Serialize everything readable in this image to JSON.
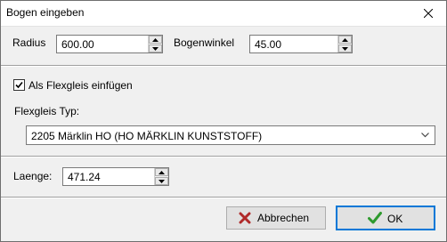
{
  "window": {
    "title": "Bogen eingeben"
  },
  "radius": {
    "label": "Radius",
    "value": "600.00"
  },
  "bogenwinkel": {
    "label": "Bogenwinkel",
    "value": "45.00"
  },
  "flexgleis": {
    "checkbox_label": "Als Flexgleis einfügen",
    "checked": true,
    "type_label": "Flexgleis Typ:",
    "selected": "2205 Märklin HO (HO MÄRKLIN KUNSTSTOFF)"
  },
  "laenge": {
    "label": "Laenge:",
    "value": "471.24"
  },
  "buttons": {
    "cancel": "Abbrechen",
    "ok": "OK"
  },
  "colors": {
    "accent": "#0078d7",
    "ok_check": "#2e9a2e",
    "cancel_x": "#b02a2a"
  }
}
